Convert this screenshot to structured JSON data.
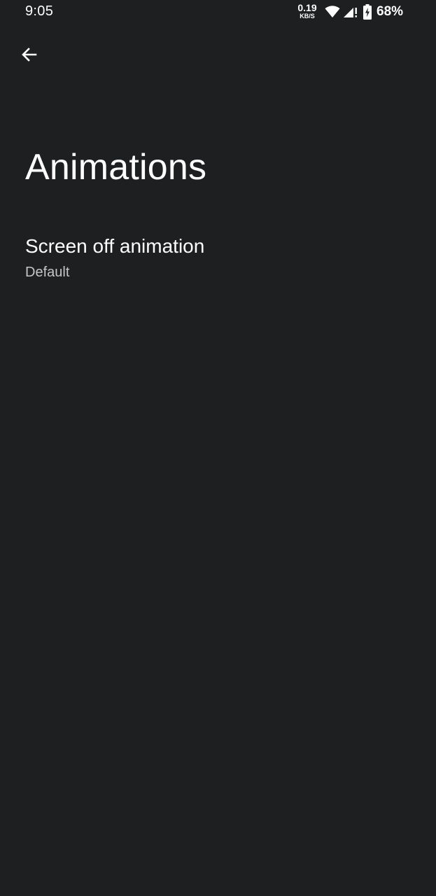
{
  "status_bar": {
    "time": "9:05",
    "net_speed": {
      "value": "0.19",
      "unit": "KB/S"
    },
    "icons": [
      "wifi-icon",
      "signal-icon",
      "battery-charging-icon"
    ],
    "battery": "68%"
  },
  "toolbar": {
    "back_icon": "back-arrow-icon"
  },
  "page": {
    "title": "Animations"
  },
  "settings": [
    {
      "title": "Screen off animation",
      "summary": "Default"
    }
  ],
  "colors": {
    "background": "#1e1f21",
    "text_primary": "#ffffff",
    "text_secondary": "#c4c7c5"
  }
}
